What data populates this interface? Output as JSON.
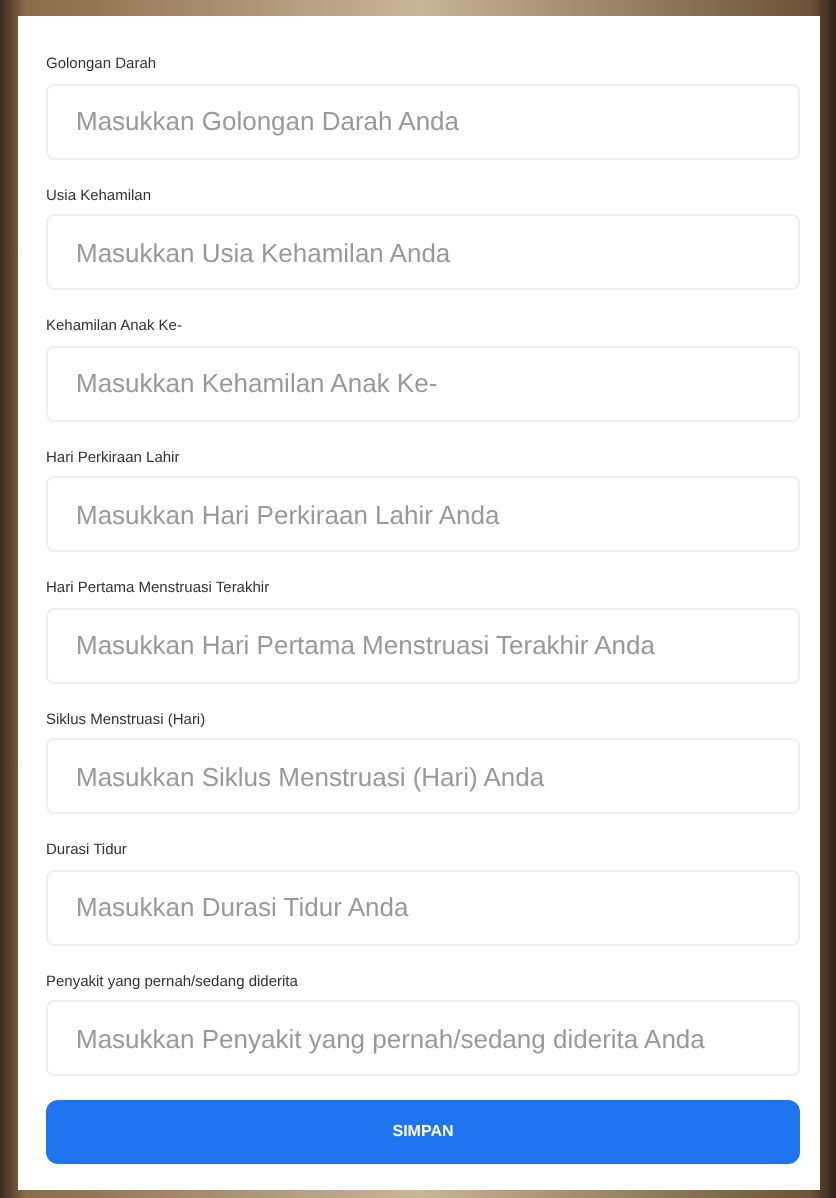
{
  "form": {
    "fields": [
      {
        "label": "Golongan Darah",
        "placeholder": "Masukkan Golongan Darah Anda"
      },
      {
        "label": "Usia Kehamilan",
        "placeholder": "Masukkan Usia Kehamilan Anda"
      },
      {
        "label": "Kehamilan Anak Ke-",
        "placeholder": "Masukkan Kehamilan Anak Ke-"
      },
      {
        "label": "Hari Perkiraan Lahir",
        "placeholder": "Masukkan Hari Perkiraan Lahir Anda"
      },
      {
        "label": "Hari Pertama Menstruasi Terakhir",
        "placeholder": "Masukkan Hari Pertama Menstruasi Terakhir Anda"
      },
      {
        "label": "Siklus Menstruasi (Hari)",
        "placeholder": "Masukkan Siklus Menstruasi (Hari) Anda"
      },
      {
        "label": "Durasi Tidur",
        "placeholder": "Masukkan Durasi Tidur Anda"
      },
      {
        "label": "Penyakit yang pernah/sedang diderita",
        "placeholder": "Masukkan Penyakit yang pernah/sedang diderita Anda"
      }
    ],
    "submit": "SIMPAN"
  }
}
